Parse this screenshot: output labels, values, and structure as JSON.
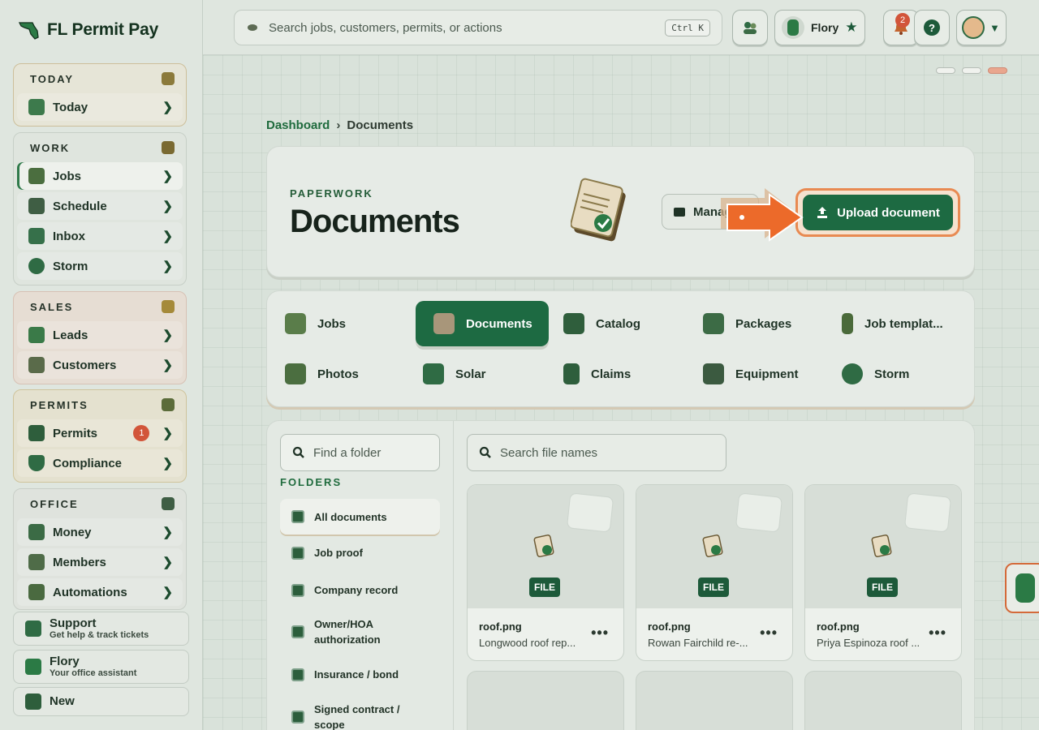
{
  "brand": {
    "name": "FL Permit Pay"
  },
  "sidebar": {
    "sections": [
      {
        "title": "TODAY",
        "items": [
          {
            "label": "Today"
          }
        ]
      },
      {
        "title": "WORK",
        "items": [
          {
            "label": "Jobs"
          },
          {
            "label": "Schedule"
          },
          {
            "label": "Inbox"
          },
          {
            "label": "Storm"
          }
        ]
      },
      {
        "title": "SALES",
        "items": [
          {
            "label": "Leads"
          },
          {
            "label": "Customers"
          }
        ]
      },
      {
        "title": "PERMITS",
        "items": [
          {
            "label": "Permits",
            "badge": "1"
          },
          {
            "label": "Compliance"
          }
        ]
      },
      {
        "title": "OFFICE",
        "items": [
          {
            "label": "Money"
          },
          {
            "label": "Members"
          },
          {
            "label": "Automations"
          }
        ]
      }
    ],
    "bottom": [
      {
        "title": "Support",
        "sub": "Get help & track tickets"
      },
      {
        "title": "Flory",
        "sub": "Your office assistant"
      },
      {
        "title": "New"
      }
    ]
  },
  "topbar": {
    "search_placeholder": "Search jobs, customers, permits, or actions",
    "shortcut": "Ctrl K",
    "assistant_label": "Flory",
    "notification_count": "2"
  },
  "breadcrumb": {
    "root": "Dashboard",
    "sep": "›",
    "current": "Documents"
  },
  "hero": {
    "eyebrow": "PAPERWORK",
    "title": "Documents",
    "manage_label": "Manage",
    "upload_label": "Upload document"
  },
  "tabs": [
    {
      "label": "Jobs"
    },
    {
      "label": "Documents"
    },
    {
      "label": "Catalog"
    },
    {
      "label": "Packages"
    },
    {
      "label": "Job templat..."
    },
    {
      "label": "Photos"
    },
    {
      "label": "Solar"
    },
    {
      "label": "Claims"
    },
    {
      "label": "Equipment"
    },
    {
      "label": "Storm"
    }
  ],
  "folders": {
    "search_placeholder": "Find a folder",
    "heading": "FOLDERS",
    "items": [
      {
        "label": "All documents"
      },
      {
        "label": "Job proof"
      },
      {
        "label": "Company record"
      },
      {
        "label": "Owner/HOA authorization"
      },
      {
        "label": "Insurance / bond"
      },
      {
        "label": "Signed contract / scope"
      }
    ]
  },
  "files": {
    "search_placeholder": "Search file names",
    "items": [
      {
        "tag": "FILE",
        "name": "roof.png",
        "desc": "Longwood roof rep..."
      },
      {
        "tag": "FILE",
        "name": "roof.png",
        "desc": "Rowan Fairchild re-..."
      },
      {
        "tag": "FILE",
        "name": "roof.png",
        "desc": "Priya Espinoza roof ..."
      }
    ],
    "more": "•••"
  },
  "colors": {
    "accent": "#1d6a42",
    "highlight": "#e88a52",
    "badge": "#d2553a"
  },
  "icons": [
    "search-icon",
    "folder-icon",
    "upload-icon",
    "help-icon",
    "bell-icon",
    "star-icon",
    "chevron-right-icon",
    "chevron-down-icon"
  ]
}
